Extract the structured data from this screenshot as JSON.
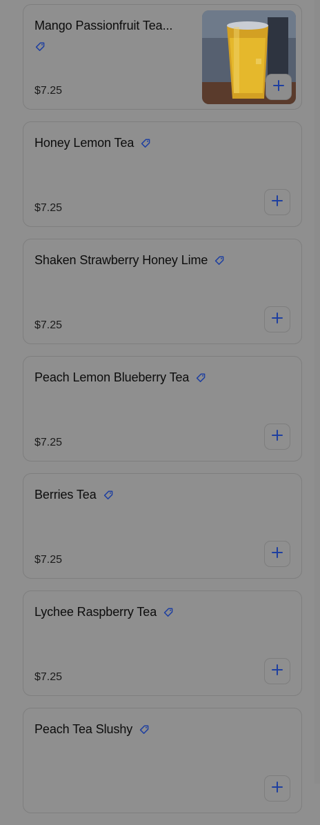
{
  "menu": {
    "items": [
      {
        "name": "Mango Passionfruit Tea...",
        "price": "$7.25",
        "has_image": true
      },
      {
        "name": "Honey Lemon Tea",
        "price": "$7.25"
      },
      {
        "name": "Shaken Strawberry Honey Lime",
        "price": "$7.25"
      },
      {
        "name": "Peach Lemon Blueberry Tea",
        "price": "$7.25"
      },
      {
        "name": "Berries Tea",
        "price": "$7.25"
      },
      {
        "name": "Lychee Raspberry Tea",
        "price": "$7.25"
      },
      {
        "name": "Peach Tea Slushy",
        "price": ""
      }
    ]
  },
  "icons": {
    "tag": "tag-icon",
    "add": "plus-icon"
  },
  "colors": {
    "overlay_bg": "#8f8f8f",
    "accent_blue": "#1e3fa0",
    "text": "#0c0c0c"
  }
}
